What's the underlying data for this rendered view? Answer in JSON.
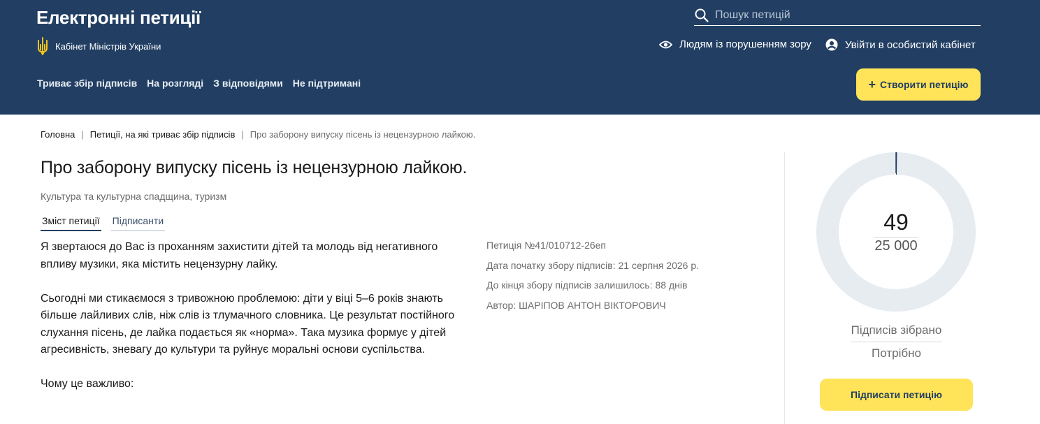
{
  "header": {
    "site_title": "Електронні петиції",
    "gov_label": "Кабінет Міністрів України",
    "search_placeholder": "Пошук петицій",
    "a11y_label": "Людям із порушенням зору",
    "login_label": "Увійти в особистий кабінет",
    "create_label": "Створити петицію",
    "create_plus": "+",
    "nav": [
      "Триває збір підписів",
      "На розгляді",
      "З відповідями",
      "Не підтримані"
    ]
  },
  "breadcrumb": {
    "home": "Головна",
    "section": "Петиції, на які триває збір підписів",
    "current": "Про заборону випуску пісень із нецензурною лайкою.",
    "separator": "|"
  },
  "petition": {
    "title": "Про заборону випуску пісень із нецензурною лайкою.",
    "category": "Культура та культурна спадщина, туризм",
    "tabs": [
      "Зміст петиції",
      "Підписанти"
    ],
    "paragraphs": [
      "Я звертаюся до Вас із проханням захистити дітей та молодь від негативного впливу музики, яка містить нецензурну лайку.",
      "Сьогодні ми стикаємося з тривожною проблемою: діти у віці 5–6 років знають більше лайливих слів, ніж слів із тлумачного словника. Це результат постійного слухання пісень, де лайка подається як «норма». Така музика формує у дітей агресивність, зневагу до культури та руйнує моральні основи суспільства.",
      "Чому це важливо:"
    ],
    "meta": {
      "number": "Петиція №41/010712-26еп",
      "start_date": "Дата початку збору підписів: 21 серпня 2026 р.",
      "remaining": "До кінця збору підписів залишилось: 88 днів",
      "author": "Автор: ШАРІПОВ АНТОН ВІКТОРОВИЧ"
    }
  },
  "signatures": {
    "collected": 49,
    "collected_text": "49",
    "target_text": "25 000",
    "target": 25000,
    "collected_label": "Підписів зібрано",
    "needed_label": "Потрібно",
    "sign_label": "Підписати петицію"
  },
  "colors": {
    "header_bg": "#223f63",
    "accent_yellow": "#ffe358",
    "ring_track": "#e7ecf1",
    "ring_progress": "#223f63"
  }
}
